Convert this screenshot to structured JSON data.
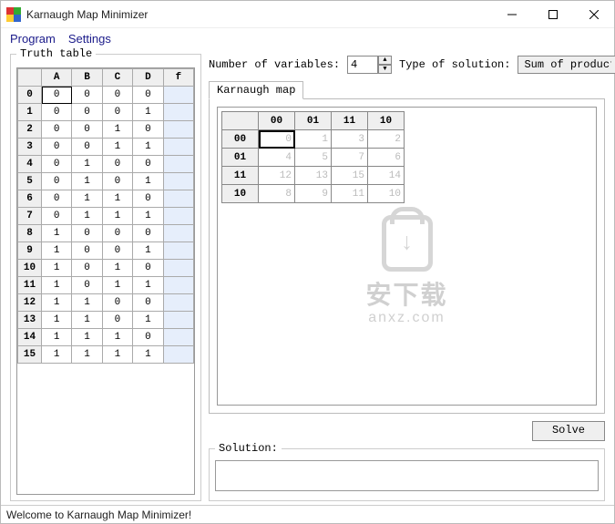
{
  "title": "Karnaugh Map Minimizer",
  "menu": {
    "program": "Program",
    "settings": "Settings"
  },
  "labels": {
    "truth_table": "Truth table",
    "num_vars": "Number of variables:",
    "type_sol": "Type of solution:",
    "kmap_tab": "Karnaugh map",
    "solve": "Solve",
    "solution": "Solution:"
  },
  "num_vars_value": "4",
  "solution_type": "Sum of products",
  "status": "Welcome to Karnaugh Map Minimizer!",
  "watermark": {
    "line1": "安下载",
    "line2": "anxz.com"
  },
  "truth_table": {
    "headers": [
      "",
      "A",
      "B",
      "C",
      "D",
      "f"
    ],
    "rows": [
      {
        "idx": "0",
        "vals": [
          "0",
          "0",
          "0",
          "0"
        ],
        "f": ""
      },
      {
        "idx": "1",
        "vals": [
          "0",
          "0",
          "0",
          "1"
        ],
        "f": ""
      },
      {
        "idx": "2",
        "vals": [
          "0",
          "0",
          "1",
          "0"
        ],
        "f": ""
      },
      {
        "idx": "3",
        "vals": [
          "0",
          "0",
          "1",
          "1"
        ],
        "f": ""
      },
      {
        "idx": "4",
        "vals": [
          "0",
          "1",
          "0",
          "0"
        ],
        "f": ""
      },
      {
        "idx": "5",
        "vals": [
          "0",
          "1",
          "0",
          "1"
        ],
        "f": ""
      },
      {
        "idx": "6",
        "vals": [
          "0",
          "1",
          "1",
          "0"
        ],
        "f": ""
      },
      {
        "idx": "7",
        "vals": [
          "0",
          "1",
          "1",
          "1"
        ],
        "f": ""
      },
      {
        "idx": "8",
        "vals": [
          "1",
          "0",
          "0",
          "0"
        ],
        "f": ""
      },
      {
        "idx": "9",
        "vals": [
          "1",
          "0",
          "0",
          "1"
        ],
        "f": ""
      },
      {
        "idx": "10",
        "vals": [
          "1",
          "0",
          "1",
          "0"
        ],
        "f": ""
      },
      {
        "idx": "11",
        "vals": [
          "1",
          "0",
          "1",
          "1"
        ],
        "f": ""
      },
      {
        "idx": "12",
        "vals": [
          "1",
          "1",
          "0",
          "0"
        ],
        "f": ""
      },
      {
        "idx": "13",
        "vals": [
          "1",
          "1",
          "0",
          "1"
        ],
        "f": ""
      },
      {
        "idx": "14",
        "vals": [
          "1",
          "1",
          "1",
          "0"
        ],
        "f": ""
      },
      {
        "idx": "15",
        "vals": [
          "1",
          "1",
          "1",
          "1"
        ],
        "f": ""
      }
    ],
    "selected_row": 0,
    "selected_col": 0
  },
  "kmap": {
    "col_headers": [
      "00",
      "01",
      "11",
      "10"
    ],
    "row_headers": [
      "00",
      "01",
      "11",
      "10"
    ],
    "cells": [
      [
        "0",
        "1",
        "3",
        "2"
      ],
      [
        "4",
        "5",
        "7",
        "6"
      ],
      [
        "12",
        "13",
        "15",
        "14"
      ],
      [
        "8",
        "9",
        "11",
        "10"
      ]
    ],
    "selected": [
      0,
      0
    ]
  },
  "solution_text": ""
}
